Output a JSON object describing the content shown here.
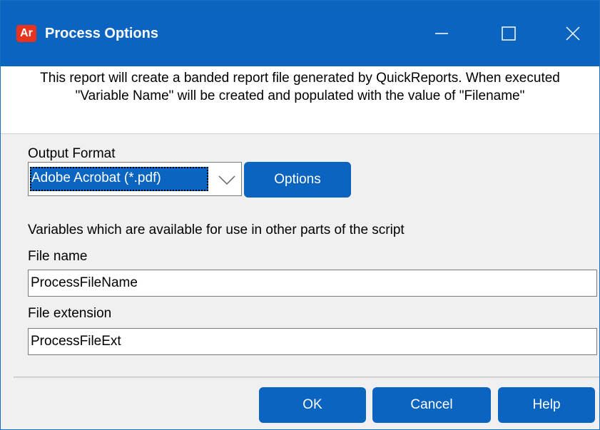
{
  "window": {
    "title": "Process Options",
    "app_icon": {
      "name": "ar-app-icon",
      "text": "Ar"
    },
    "controls": {
      "minimize": "minimize-icon",
      "maximize": "maximize-icon",
      "close": "close-icon"
    }
  },
  "description": "This report will create a banded report file generated by QuickReports.  When executed \"Variable Name\" will be created and populated with the value of \"Filename\"",
  "output_format": {
    "label": "Output Format",
    "selected": "Adobe Acrobat (*.pdf)",
    "options_button": "Options"
  },
  "variables": {
    "heading": "Variables which are available for use in other parts of the script",
    "file_name_label": "File name",
    "file_name_value": "ProcessFileName",
    "file_ext_label": "File extension",
    "file_ext_value": "ProcessFileExt"
  },
  "footer": {
    "ok": "OK",
    "cancel": "Cancel",
    "help": "Help"
  },
  "colors": {
    "accent": "#0a64c0",
    "app_icon": "#e8331f"
  }
}
